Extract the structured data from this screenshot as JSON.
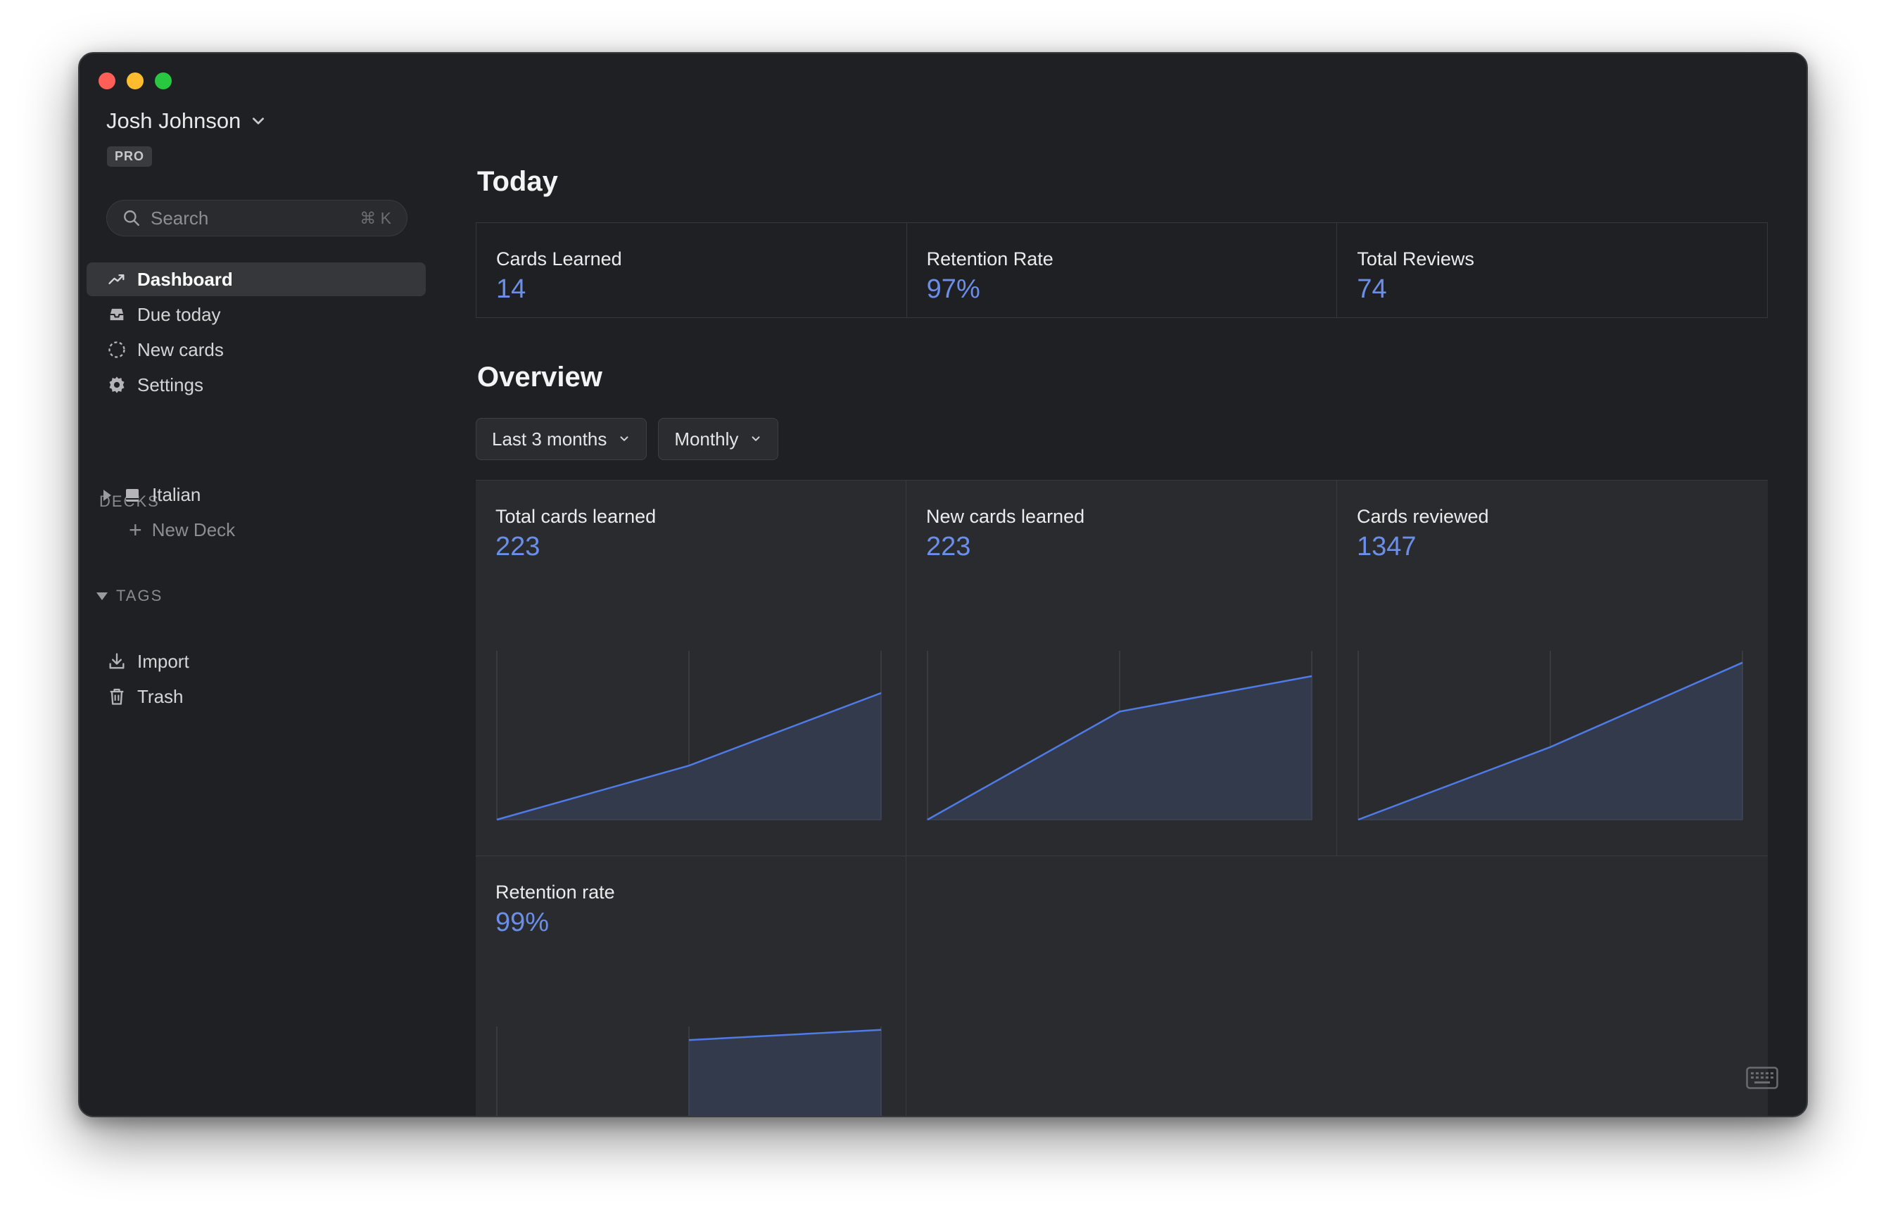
{
  "window": {
    "controls": [
      "close",
      "minimize",
      "zoom"
    ]
  },
  "sidebar": {
    "user_name": "Josh Johnson",
    "plan_badge": "PRO",
    "search": {
      "placeholder": "Search",
      "shortcut": "⌘ K"
    },
    "nav": [
      {
        "label": "Dashboard",
        "icon": "trend-up-icon",
        "active": true
      },
      {
        "label": "Due today",
        "icon": "inbox-icon",
        "active": false
      },
      {
        "label": "New cards",
        "icon": "dashed-circle-icon",
        "active": false
      },
      {
        "label": "Settings",
        "icon": "gear-icon",
        "active": false
      }
    ],
    "decks_label": "DECKS",
    "decks": [
      {
        "label": "Italian",
        "icon": "book-icon"
      }
    ],
    "new_deck_label": "New Deck",
    "tags_label": "TAGS",
    "bottom_nav": [
      {
        "label": "Import",
        "icon": "download-icon"
      },
      {
        "label": "Trash",
        "icon": "trash-icon"
      }
    ]
  },
  "main": {
    "today_title": "Today",
    "today_stats": [
      {
        "label": "Cards Learned",
        "value": "14"
      },
      {
        "label": "Retention Rate",
        "value": "97%"
      },
      {
        "label": "Total Reviews",
        "value": "74"
      }
    ],
    "overview_title": "Overview",
    "filters": {
      "range": "Last 3 months",
      "interval": "Monthly"
    }
  },
  "colors": {
    "accent": "#6b8fe8",
    "line": "#4f7be6",
    "area": "#333a4c",
    "window_bg": "#1f2023",
    "panel_bg": "#2a2b2e"
  },
  "chart_data": [
    {
      "type": "area",
      "title": "Total cards learned",
      "value": "223",
      "x": [
        0,
        1,
        2
      ],
      "y": [
        0,
        0.32,
        0.75
      ],
      "ylim": [
        0,
        1
      ]
    },
    {
      "type": "area",
      "title": "New cards learned",
      "value": "223",
      "x": [
        0,
        1,
        2
      ],
      "y": [
        0,
        0.64,
        0.85
      ],
      "ylim": [
        0,
        1
      ]
    },
    {
      "type": "area",
      "title": "Cards reviewed",
      "value": "1347",
      "x": [
        0,
        1,
        2
      ],
      "y": [
        0,
        0.43,
        0.93
      ],
      "ylim": [
        0,
        1
      ]
    },
    {
      "type": "area",
      "title": "Retention rate",
      "value": "99%",
      "x": [
        1,
        2
      ],
      "y": [
        0.96,
        0.99
      ],
      "ylim": [
        0.5,
        1
      ]
    }
  ]
}
